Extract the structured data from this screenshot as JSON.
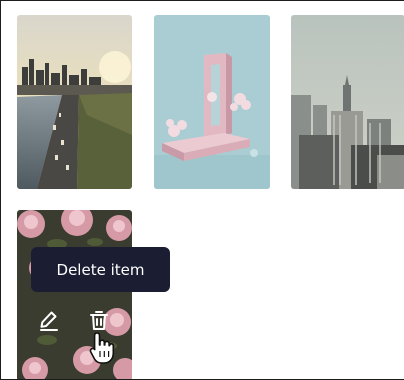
{
  "gallery": {
    "items": [
      {
        "name": "city-river-highway-photo"
      },
      {
        "name": "pastel-sculpture-photo"
      },
      {
        "name": "city-skyline-photo"
      },
      {
        "name": "pink-flowers-photo"
      }
    ],
    "actions": {
      "edit_icon": "pencil-icon",
      "delete_icon": "trash-icon"
    },
    "tooltip": {
      "text": "Delete item"
    }
  }
}
